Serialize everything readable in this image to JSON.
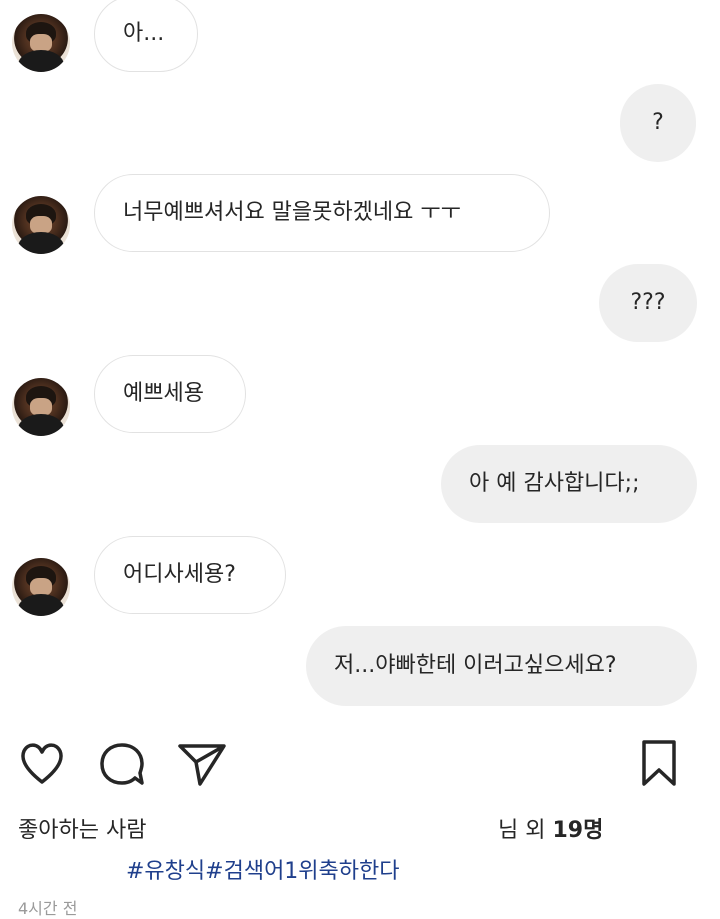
{
  "messages": [
    {
      "side": "in",
      "text": "아..."
    },
    {
      "side": "out",
      "text": "?"
    },
    {
      "side": "in",
      "text": "너무예쁘셔서요 말을못하겠네요 ㅜㅜ"
    },
    {
      "side": "out",
      "text": "???"
    },
    {
      "side": "in",
      "text": "예쁘세용"
    },
    {
      "side": "out",
      "text": "아 예 감사합니다;;"
    },
    {
      "side": "in",
      "text": "어디사세용?"
    },
    {
      "side": "out",
      "text": "저...야빠한테 이러고싶으세요?"
    }
  ],
  "post": {
    "likes_prefix": "좋아하는 사람 ",
    "likes_suffix_a": "님 외 ",
    "likes_count": "19명",
    "hashtags": "#유창식#검색어1위축하한다",
    "time": "4시간 전"
  },
  "icons": {
    "like": "heart-icon",
    "comment": "comment-icon",
    "share": "send-icon",
    "save": "bookmark-icon"
  }
}
